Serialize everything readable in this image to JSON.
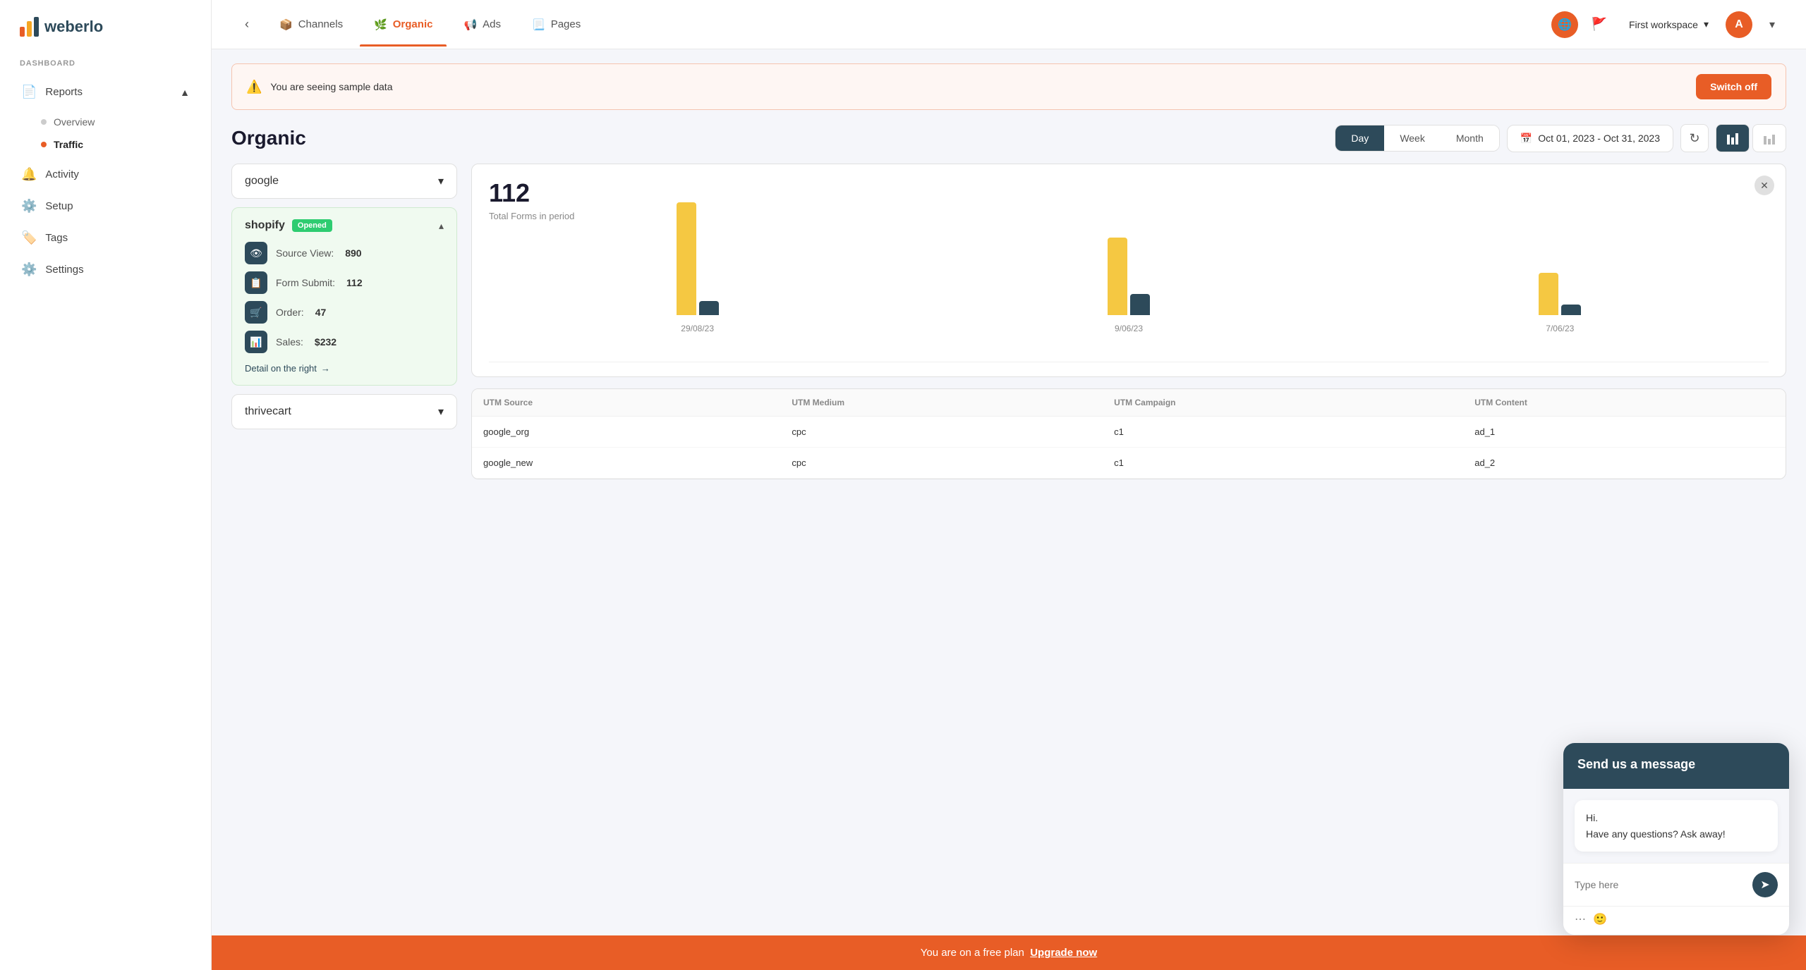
{
  "brand": {
    "name": "weberlo"
  },
  "sidebar": {
    "section_label": "DASHBOARD",
    "items": [
      {
        "id": "reports",
        "label": "Reports",
        "icon": "📄",
        "expandable": true,
        "expanded": true
      },
      {
        "id": "activity",
        "label": "Activity",
        "icon": "🔔",
        "expandable": false
      },
      {
        "id": "setup",
        "label": "Setup",
        "icon": "⚙️",
        "expandable": false
      },
      {
        "id": "tags",
        "label": "Tags",
        "icon": "🏷️",
        "expandable": false
      },
      {
        "id": "settings",
        "label": "Settings",
        "icon": "⚙️",
        "expandable": false
      }
    ],
    "subitems": [
      {
        "id": "overview",
        "label": "Overview",
        "active": false
      },
      {
        "id": "traffic",
        "label": "Traffic",
        "active": true
      }
    ]
  },
  "topnav": {
    "tabs": [
      {
        "id": "channels",
        "label": "Channels",
        "icon": "📦",
        "active": false
      },
      {
        "id": "organic",
        "label": "Organic",
        "icon": "🌿",
        "active": true
      },
      {
        "id": "ads",
        "label": "Ads",
        "icon": "📢",
        "active": false
      },
      {
        "id": "pages",
        "label": "Pages",
        "icon": "📃",
        "active": false
      }
    ],
    "workspace": "First workspace",
    "avatar_initial": "A"
  },
  "banner": {
    "text": "You are seeing sample data",
    "switch_off_label": "Switch off"
  },
  "page": {
    "title": "Organic",
    "period_buttons": [
      "Day",
      "Week",
      "Month"
    ],
    "active_period": "Day",
    "date_range": "Oct 01, 2023 - Oct 31, 2023"
  },
  "left_panel": {
    "source_dropdown": "google",
    "shopify": {
      "name": "shopify",
      "badge": "Opened",
      "items": [
        {
          "label": "Source View:",
          "value": "890",
          "icon": "👁"
        },
        {
          "label": "Form Submit:",
          "value": "112",
          "icon": "📋"
        },
        {
          "label": "Order:",
          "value": "47",
          "icon": "🛒"
        },
        {
          "label": "Sales:",
          "value": "$232",
          "icon": "📊"
        }
      ],
      "detail_link": "Detail on the right"
    },
    "thrivecart": "thrivecart"
  },
  "chart": {
    "total": "112",
    "label": "Total Forms in period",
    "bars": [
      {
        "date": "29/08/23",
        "yellow_height": 160,
        "dark_height": 20
      },
      {
        "date": "9/06/23",
        "yellow_height": 110,
        "dark_height": 30
      },
      {
        "date": "7/06/23",
        "yellow_height": 60,
        "dark_height": 15
      }
    ]
  },
  "table": {
    "headers": [
      "UTM Source",
      "UTM Medium",
      "UTM Campaign",
      "UTM Content"
    ],
    "rows": [
      [
        "google_org",
        "cpc",
        "c1",
        "ad_1"
      ],
      [
        "google_new",
        "cpc",
        "c1",
        "ad_2"
      ]
    ]
  },
  "chat": {
    "header": "Send us a message",
    "message": "Hi.\nHave any questions? Ask away!",
    "input_placeholder": "Type here"
  },
  "free_plan": {
    "text": "You are on a free plan",
    "upgrade_label": "Upgrade now"
  }
}
